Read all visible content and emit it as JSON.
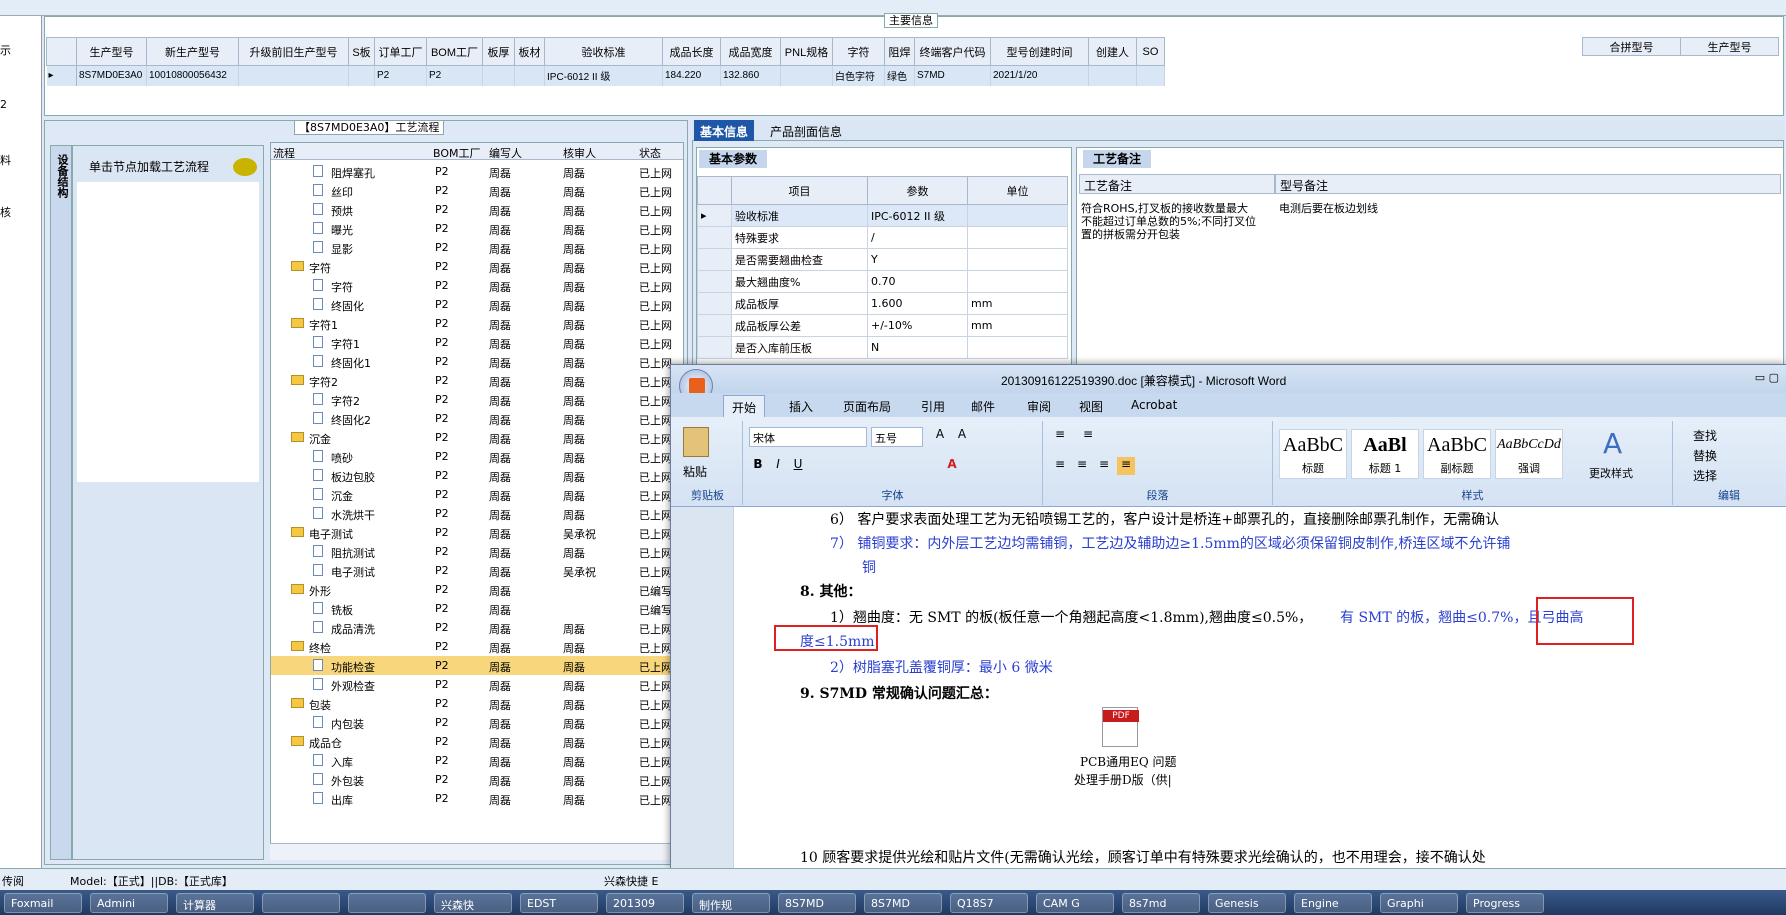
{
  "left_nav": [
    "示",
    "2",
    "料",
    "核"
  ],
  "main_info": {
    "title": "主要信息",
    "columns": [
      "生产型号",
      "新生产型号",
      "升级前旧生产型号",
      "S板",
      "订单工厂",
      "BOM工厂",
      "板厚",
      "板材",
      "验收标准",
      "成品长度",
      "成品宽度",
      "PNL规格",
      "字符",
      "阻焊",
      "终端客户代码",
      "型号创建时间",
      "创建人",
      "SO"
    ],
    "row": [
      "8S7MD0E3A0",
      "10010800056432",
      "",
      "",
      "P2",
      "P2",
      "",
      "",
      "IPC-6012 II 级",
      "184.220",
      "132.860",
      "",
      "白色字符",
      "绿色",
      "S7MD",
      "2021/1/20",
      "",
      ""
    ],
    "right_columns": [
      "合拼型号",
      "生产型号"
    ]
  },
  "flow_panel": {
    "title": "【8S7MD0E3A0】工艺流程",
    "side_tab": "设备结构",
    "load_label": "单击节点加载工艺流程",
    "headers": [
      "流程",
      "BOM工厂",
      "编写人",
      "核审人",
      "状态"
    ],
    "rows": [
      {
        "name": "阻焊塞孔",
        "lvl": 2,
        "f": "P2",
        "w": "周磊",
        "r": "周磊",
        "s": "已上网"
      },
      {
        "name": "丝印",
        "lvl": 2,
        "f": "P2",
        "w": "周磊",
        "r": "周磊",
        "s": "已上网"
      },
      {
        "name": "预烘",
        "lvl": 2,
        "f": "P2",
        "w": "周磊",
        "r": "周磊",
        "s": "已上网"
      },
      {
        "name": "曝光",
        "lvl": 2,
        "f": "P2",
        "w": "周磊",
        "r": "周磊",
        "s": "已上网"
      },
      {
        "name": "显影",
        "lvl": 2,
        "f": "P2",
        "w": "周磊",
        "r": "周磊",
        "s": "已上网"
      },
      {
        "name": "字符",
        "lvl": 1,
        "f": "P2",
        "w": "周磊",
        "r": "周磊",
        "s": "已上网"
      },
      {
        "name": "字符",
        "lvl": 2,
        "f": "P2",
        "w": "周磊",
        "r": "周磊",
        "s": "已上网"
      },
      {
        "name": "终固化",
        "lvl": 2,
        "f": "P2",
        "w": "周磊",
        "r": "周磊",
        "s": "已上网"
      },
      {
        "name": "字符1",
        "lvl": 1,
        "f": "P2",
        "w": "周磊",
        "r": "周磊",
        "s": "已上网"
      },
      {
        "name": "字符1",
        "lvl": 2,
        "f": "P2",
        "w": "周磊",
        "r": "周磊",
        "s": "已上网"
      },
      {
        "name": "终固化1",
        "lvl": 2,
        "f": "P2",
        "w": "周磊",
        "r": "周磊",
        "s": "已上网"
      },
      {
        "name": "字符2",
        "lvl": 1,
        "f": "P2",
        "w": "周磊",
        "r": "周磊",
        "s": "已上网"
      },
      {
        "name": "字符2",
        "lvl": 2,
        "f": "P2",
        "w": "周磊",
        "r": "周磊",
        "s": "已上网"
      },
      {
        "name": "终固化2",
        "lvl": 2,
        "f": "P2",
        "w": "周磊",
        "r": "周磊",
        "s": "已上网"
      },
      {
        "name": "沉金",
        "lvl": 1,
        "f": "P2",
        "w": "周磊",
        "r": "周磊",
        "s": "已上网"
      },
      {
        "name": "喷砂",
        "lvl": 2,
        "f": "P2",
        "w": "周磊",
        "r": "周磊",
        "s": "已上网"
      },
      {
        "name": "板边包胶",
        "lvl": 2,
        "f": "P2",
        "w": "周磊",
        "r": "周磊",
        "s": "已上网"
      },
      {
        "name": "沉金",
        "lvl": 2,
        "f": "P2",
        "w": "周磊",
        "r": "周磊",
        "s": "已上网"
      },
      {
        "name": "水洗烘干",
        "lvl": 2,
        "f": "P2",
        "w": "周磊",
        "r": "周磊",
        "s": "已上网"
      },
      {
        "name": "电子测试",
        "lvl": 1,
        "f": "P2",
        "w": "周磊",
        "r": "吴承祝",
        "s": "已上网"
      },
      {
        "name": "阻抗测试",
        "lvl": 2,
        "f": "P2",
        "w": "周磊",
        "r": "周磊",
        "s": "已上网"
      },
      {
        "name": "电子测试",
        "lvl": 2,
        "f": "P2",
        "w": "周磊",
        "r": "吴承祝",
        "s": "已上网"
      },
      {
        "name": "外形",
        "lvl": 1,
        "f": "P2",
        "w": "周磊",
        "r": "",
        "s": "已编写"
      },
      {
        "name": "铣板",
        "lvl": 2,
        "f": "P2",
        "w": "周磊",
        "r": "",
        "s": "已编写"
      },
      {
        "name": "成品清洗",
        "lvl": 2,
        "f": "P2",
        "w": "周磊",
        "r": "周磊",
        "s": "已上网"
      },
      {
        "name": "终检",
        "lvl": 1,
        "f": "P2",
        "w": "周磊",
        "r": "周磊",
        "s": "已上网"
      },
      {
        "name": "功能检查",
        "lvl": 2,
        "f": "P2",
        "w": "周磊",
        "r": "周磊",
        "s": "已上网",
        "sel": true
      },
      {
        "name": "外观检查",
        "lvl": 2,
        "f": "P2",
        "w": "周磊",
        "r": "周磊",
        "s": "已上网"
      },
      {
        "name": "包装",
        "lvl": 1,
        "f": "P2",
        "w": "周磊",
        "r": "周磊",
        "s": "已上网"
      },
      {
        "name": "内包装",
        "lvl": 2,
        "f": "P2",
        "w": "周磊",
        "r": "周磊",
        "s": "已上网"
      },
      {
        "name": "成品仓",
        "lvl": 1,
        "f": "P2",
        "w": "周磊",
        "r": "周磊",
        "s": "已上网"
      },
      {
        "name": "入库",
        "lvl": 2,
        "f": "P2",
        "w": "周磊",
        "r": "周磊",
        "s": "已上网"
      },
      {
        "name": "外包装",
        "lvl": 2,
        "f": "P2",
        "w": "周磊",
        "r": "周磊",
        "s": "已上网"
      },
      {
        "name": "出库",
        "lvl": 2,
        "f": "P2",
        "w": "周磊",
        "r": "周磊",
        "s": "已上网"
      }
    ]
  },
  "info_tabs": {
    "active": "基本信息",
    "other": "产品剖面信息"
  },
  "basic": {
    "title": "基本参数",
    "headers": [
      "项目",
      "参数",
      "单位"
    ],
    "rows": [
      [
        "验收标准",
        "IPC-6012 II 级",
        ""
      ],
      [
        "特殊要求",
        "/",
        ""
      ],
      [
        "是否需要翘曲检查",
        "Y",
        ""
      ],
      [
        "最大翘曲度%",
        "0.70",
        ""
      ],
      [
        "成品板厚",
        "1.600",
        "mm"
      ],
      [
        "成品板厚公差",
        "+/-10%",
        "mm"
      ],
      [
        "是否入库前压板",
        "N",
        ""
      ]
    ]
  },
  "process_notes": {
    "title": "工艺备注",
    "h1": "工艺备注",
    "h2": "型号备注",
    "note1": "符合ROHS,打叉板的接收数量最大不能超过订单总数的5%;不同打叉位置的拼板需分开包装",
    "note2": "电测后要在板边划线"
  },
  "word": {
    "title": "20130916122519390.doc [兼容模式] - Microsoft Word",
    "tabs": [
      "开始",
      "插入",
      "页面布局",
      "引用",
      "邮件",
      "审阅",
      "视图",
      "Acrobat"
    ],
    "font": "宋体",
    "size": "五号",
    "groups": [
      "剪贴板",
      "字体",
      "段落",
      "样式",
      "编辑"
    ],
    "paste": "粘贴",
    "styles": [
      {
        "s": "AaBbC",
        "n": "标题"
      },
      {
        "s": "AaBl",
        "n": "标题 1"
      },
      {
        "s": "AaBbC",
        "n": "副标题"
      },
      {
        "s": "AaBbCcDd",
        "n": "强调"
      }
    ],
    "change_style": "更改样式",
    "edit": [
      "查找",
      "替换",
      "选择"
    ],
    "lines": {
      "l1": "6） 客户要求表面处理工艺为无铅喷锡工艺的，客户设计是桥连+邮票孔的，直接删除邮票孔制作，无需确认",
      "l2": "7） 铺铜要求：内外层工艺边均需铺铜，工艺边及辅助边≥1.5mm的区域必须保留铜皮制作,桥连区域不允许铺",
      "l3": "铜",
      "l4": "8.   其他：",
      "l5a": "1）翘曲度：无 SMT 的板(板任意一个角翘起高度<1.8mm),翘曲度≤0.5%，",
      "l5b": "有 SMT 的板，翘曲≤0.7%，且弓曲高",
      "l6": "度≤1.5mm",
      "l7": "2）树脂塞孔盖覆铜厚：最小 6 微米",
      "l8": "9.   S7MD 常规确认问题汇总：",
      "pdf1": "PCB通用EQ 问题",
      "pdf2": "处理手册D版（供|",
      "l9": "10   顾客要求提供光绘和贴片文件(无需确认光绘，顾客订单中有特殊要求光绘确认的，也不用理会，接不确认处"
    }
  },
  "status": {
    "left": "传阅",
    "model": "Model:【正式】||DB:【正式库】",
    "right": "兴森快捷 E"
  },
  "taskbar": [
    "Foxmail",
    "Admini",
    "计算器",
    "",
    "",
    "兴森快",
    "EDST",
    "201309",
    "制作规",
    "8S7MD",
    "8S7MD",
    "Q18S7",
    "CAM G",
    "8s7md",
    "Genesis",
    "Engine",
    "Graphi",
    "Progress"
  ]
}
